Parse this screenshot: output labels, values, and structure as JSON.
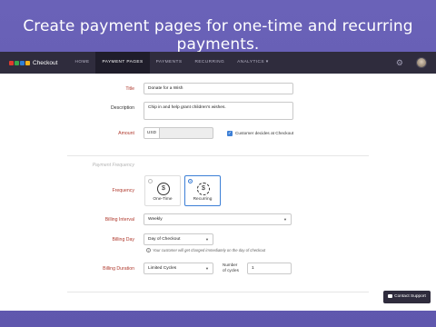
{
  "headline": "Create payment pages for one-time and recurring payments.",
  "app": {
    "logo_text": "Checkout",
    "logo_colors": [
      "#e23b2e",
      "#38a84c",
      "#2f7fd6",
      "#f2b51f"
    ],
    "nav": [
      {
        "label": "HOME"
      },
      {
        "label": "PAYMENT PAGES"
      },
      {
        "label": "PAYMENTS"
      },
      {
        "label": "RECURRING"
      },
      {
        "label": "ANALYTICS ▾"
      }
    ],
    "active_nav": "PAYMENT PAGES"
  },
  "form": {
    "title": {
      "label": "Title",
      "value": "Donate for a Wish"
    },
    "description": {
      "label": "Description",
      "value": "Chip in and help grant children's wishes."
    },
    "amount": {
      "label": "Amount",
      "currency": "USD",
      "value": ""
    },
    "customer_decides": {
      "label": "Customer decides at Checkout",
      "checked": true
    },
    "section_title": "Payment Frequency",
    "frequency": {
      "label": "Frequency",
      "options": [
        {
          "label": "One-Time",
          "icon": "dollar-coin-icon",
          "selected": false
        },
        {
          "label": "Recurring",
          "icon": "recurring-coin-icon",
          "selected": true
        }
      ]
    },
    "billing_interval": {
      "label": "Billing Interval",
      "value": "Weekly"
    },
    "billing_day": {
      "label": "Billing Day",
      "value": "Day of Checkout"
    },
    "billing_hint": "Your customer will get charged immediately on the day of checkout",
    "billing_duration": {
      "label": "Billing Duration",
      "value": "Limited Cycles"
    },
    "cycles": {
      "label_line1": "Number",
      "label_line2": "of cycles",
      "value": "1"
    }
  },
  "contact_support": "Contact Support"
}
